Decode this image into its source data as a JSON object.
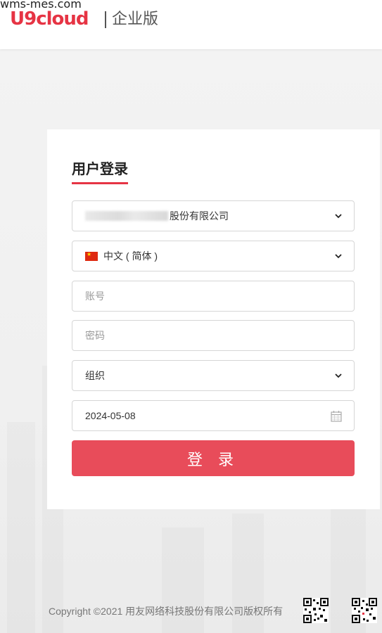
{
  "watermark": "wms-mes.com",
  "header": {
    "logo": "U9cloud",
    "edition": "企业版"
  },
  "login": {
    "title": "用户登录",
    "company_suffix": "股份有限公司",
    "language": "中文 ( 简体 )",
    "account_placeholder": "账号",
    "password_placeholder": "密码",
    "org_placeholder": "组织",
    "date": "2024-05-08",
    "submit_label": "登 录"
  },
  "footer": {
    "copyright": "Copyright ©2021 用友网络科技股份有限公司版权所有"
  },
  "colors": {
    "brand": "#e63444",
    "button": "#e84c5a"
  },
  "icons": [
    "chevron-down-icon",
    "calendar-icon",
    "china-flag-icon",
    "qr-code-icon"
  ]
}
